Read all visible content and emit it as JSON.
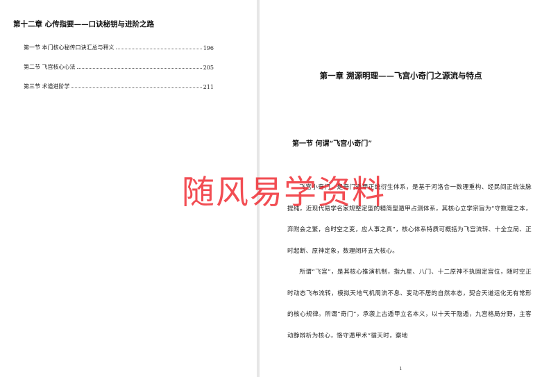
{
  "left_page": {
    "toc_heading": "第十二章 心传指要——口诀秘钥与进阶之路",
    "toc_entries": [
      {
        "title": "第一节 本门核心秘传口诀汇总与释义",
        "page": "196"
      },
      {
        "title": "第二节 飞宫核心心法",
        "page": "205"
      },
      {
        "title": "第三节 术道进阶学",
        "page": "211"
      }
    ]
  },
  "right_page": {
    "chapter_title": "第一章 溯源明理——飞宫小奇门之源流与特点",
    "section_title": "第一节 何谓“飞宫小奇门”",
    "paragraphs": [
      "飞宫小奇门，是奇门遁甲正统衍生体系，是基于河洛合一数理重构、经民间正统法脉提纯，近现代易学名家规整定型的精简型遁甲占测体系，其核心立学宗旨为“守数理之本，弃附会之繁，合时空之变，应人事之真”，核心体系特质可概括为飞宫流转、十全立局、正时起断、原神定象，数理闭环五大核心。",
      "所谓“飞宫”，是其核心推演机制，指九星、八门、十二原神不执固定宫位，随时空正时动态飞布流转，模拟天地气机周流不息、变动不居的自然本态，契合天道运化无有常形的核心规律。所谓“奇门”，承袭上古遁甲立名本义，以十天干隐遁，九宫格局分野，主客动静辨析为核心，恪守遁甲术“循天时，察地"
    ],
    "page_number": "1"
  },
  "watermark": "随风易学资料"
}
